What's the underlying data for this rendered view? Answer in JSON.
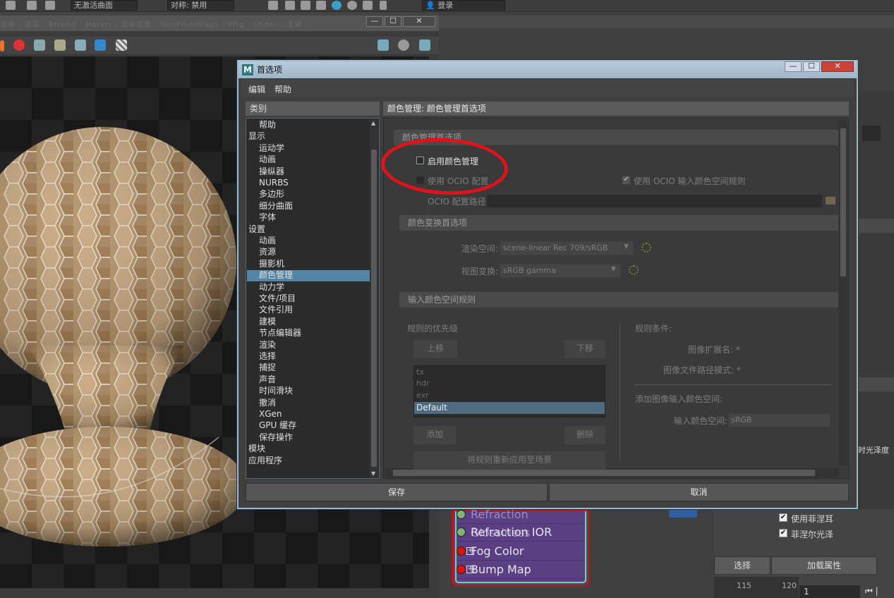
{
  "toolbar": {
    "surface_dropdown": "无激活曲面",
    "symmetry": "对称: 禁用",
    "login": "登录"
  },
  "render_view": {
    "tabs_text": "渲染 · 渲染 · Bfrend · Materi · 渲染视图 · NeoFloorMaps · Pftg · Shder · 渲染",
    "min": "—",
    "max": "☐",
    "close": "✕"
  },
  "dialog": {
    "title": "首选项",
    "min": "—",
    "max": "☐",
    "close": "✕",
    "menu": [
      "编辑",
      "帮助"
    ],
    "category_header": "类别",
    "categories": [
      {
        "label": "帮助",
        "indent": 1
      },
      {
        "label": "显示",
        "indent": 0
      },
      {
        "label": "运动学",
        "indent": 1
      },
      {
        "label": "动画",
        "indent": 1
      },
      {
        "label": "操纵器",
        "indent": 1
      },
      {
        "label": "NURBS",
        "indent": 1
      },
      {
        "label": "多边形",
        "indent": 1
      },
      {
        "label": "细分曲面",
        "indent": 1
      },
      {
        "label": "字体",
        "indent": 1
      },
      {
        "label": "设置",
        "indent": 0
      },
      {
        "label": "动画",
        "indent": 1
      },
      {
        "label": "资源",
        "indent": 1
      },
      {
        "label": "摄影机",
        "indent": 1
      },
      {
        "label": "颜色管理",
        "indent": 1,
        "selected": true
      },
      {
        "label": "动力学",
        "indent": 1
      },
      {
        "label": "文件/项目",
        "indent": 1
      },
      {
        "label": "文件引用",
        "indent": 1
      },
      {
        "label": "建模",
        "indent": 1
      },
      {
        "label": "节点编辑器",
        "indent": 1
      },
      {
        "label": "渲染",
        "indent": 1
      },
      {
        "label": "选择",
        "indent": 1
      },
      {
        "label": "捕捉",
        "indent": 1
      },
      {
        "label": "声音",
        "indent": 1
      },
      {
        "label": "时间滑块",
        "indent": 1
      },
      {
        "label": "撤消",
        "indent": 1
      },
      {
        "label": "XGen",
        "indent": 1
      },
      {
        "label": "GPU 缓存",
        "indent": 1
      },
      {
        "label": "保存操作",
        "indent": 1
      },
      {
        "label": "模块",
        "indent": 0
      },
      {
        "label": "应用程序",
        "indent": 0
      }
    ],
    "main_header": "颜色管理: 颜色管理首选项",
    "section1": "颜色管理首选项",
    "enable_cm": "启用颜色管理",
    "enable_cm_checked": false,
    "use_ocio": "使用 OCIO 配置",
    "use_ocio_checked": false,
    "use_ocio_rules": "使用 OCIO 输入颜色空间规则",
    "use_ocio_rules_checked": true,
    "ocio_path_label": "OCIO 配置路径",
    "ocio_path_value": "",
    "section2": "颜色变换首选项",
    "render_space_label": "渲染空间:",
    "render_space_value": "scene-linear Rec 709/sRGB",
    "view_transform_label": "视图变换:",
    "view_transform_value": "sRGB gamma",
    "section3": "输入颜色空间规则",
    "rule_priority": "规则的优先级",
    "move_up": "上移",
    "move_down": "下移",
    "rules": [
      "tx",
      "hdr",
      "exr",
      "Default"
    ],
    "selected_rule": "Default",
    "add": "添加",
    "delete": "删除",
    "reapply": "将规则重新应用至场景",
    "rule_conditions": "规则条件:",
    "image_ext": "图像扩展名: *",
    "image_path": "图像文件路径模式: *",
    "add_input_cs": "添加图像输入颜色空间:",
    "input_cs_label": "输入颜色空间:",
    "input_cs_value": "sRGB",
    "save": "保存",
    "cancel": "取消"
  },
  "node": {
    "rows": [
      {
        "label": "Refraction Glossiness",
        "dot": "#8ab07a",
        "plus": false
      },
      {
        "label": "Refraction IOR",
        "dot": "#8ab07a",
        "plus": false
      },
      {
        "label": "Fog Color",
        "dot": "#e01010",
        "plus": true
      },
      {
        "label": "Bump Map",
        "dot": "#e01010",
        "plus": true
      }
    ]
  },
  "attrs": {
    "use_fresnel": "使用菲涅耳",
    "fresnel_gloss": "菲涅尔光泽",
    "light_depth": "时光泽度",
    "select": "选择",
    "load_attrs": "加载属性",
    "tick1": "115",
    "tick2": "120",
    "frame": "1"
  }
}
